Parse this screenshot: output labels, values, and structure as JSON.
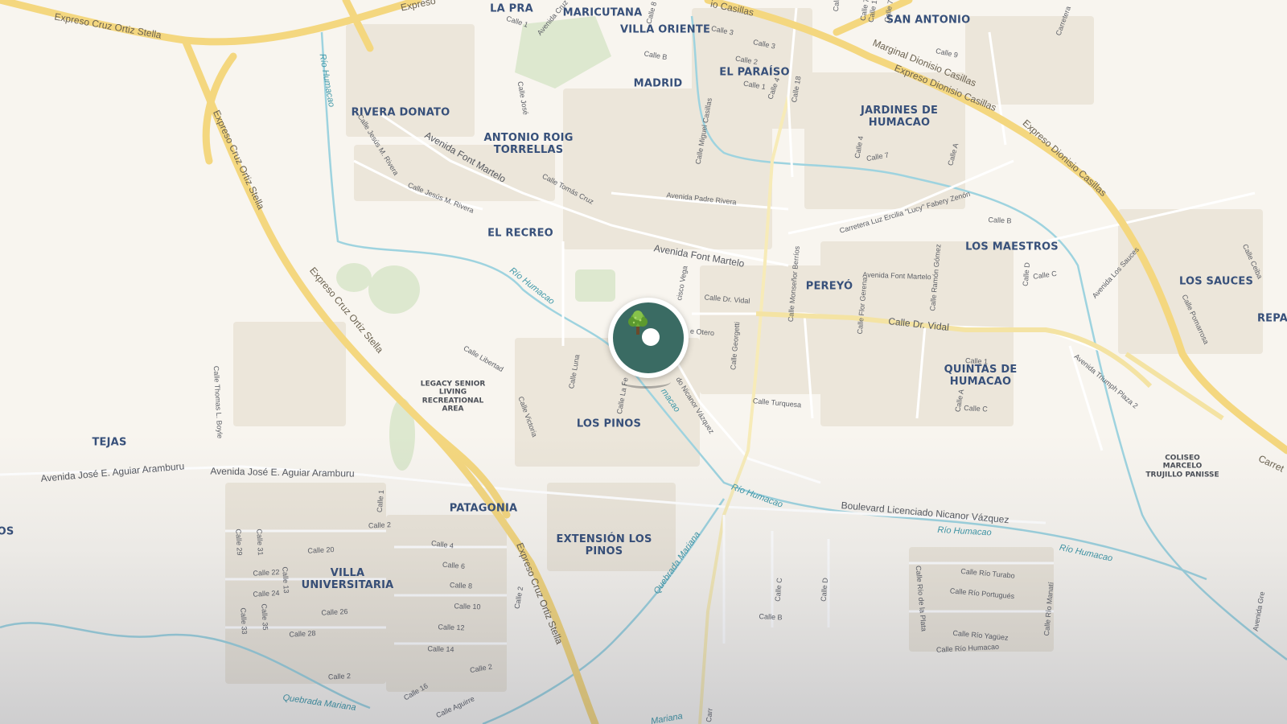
{
  "map": {
    "colors": {
      "background": "#f8f5ef",
      "highway": "#f4d77f",
      "water": "#9ed3df",
      "park": "#dde8cf",
      "street": "#ffffff",
      "marker": "#3a6b63"
    },
    "marker": {
      "icon": "tree-icon"
    },
    "neighborhoods": {
      "la_pra": "LA PRA",
      "maricutana": "MARICUTANA",
      "villa_oriente": "VILLA ORIENTE",
      "san_antonio": "SAN ANTONIO",
      "madrid": "MADRID",
      "el_paraiso": "EL PARAÍSO",
      "rivera_donato": "RIVERA DONATO",
      "antonio_roig_1": "ANTONIO ROIG",
      "antonio_roig_2": "TORRELLAS",
      "jardines_1": "JARDINES DE",
      "jardines_2": "HUMACAO",
      "el_recreo": "EL RECREO",
      "los_maestros": "LOS MAESTROS",
      "pereyo": "PEREYÓ",
      "los_sauces": "LOS SAUCES",
      "repa": "REPA",
      "quintas_1": "QUINTAS DE",
      "quintas_2": "HUMACAO",
      "tejas": "TEJAS",
      "los_pinos": "LOS PINOS",
      "patagonia": "PATAGONIA",
      "extension_1": "EXTENSIÓN LOS",
      "extension_2": "PINOS",
      "villa_univ_1": "VILLA",
      "villa_univ_2": "UNIVERSITARIA",
      "os": "OS"
    },
    "pois": {
      "legacy_1": "LEGACY SENIOR",
      "legacy_2": "LIVING",
      "legacy_3": "RECREATIONAL",
      "legacy_4": "AREA",
      "coliseo_1": "COLISEO",
      "coliseo_2": "MARCELO",
      "coliseo_3": "TRUJILLO PANISSE"
    },
    "highways": {
      "ecos_top": "Expreso Cruz Ortiz Stella",
      "ecos_left": "Expreso Cruz Ortiz Stella",
      "ecos_mid": "Expreso Cruz Ortiz Stella",
      "ecos_bottom": "Expreso Cruz Ortiz Stella",
      "expreso_top": "Expreso",
      "casillas_top": "io Casillas",
      "marginal": "Marginal Dionisio Casillas",
      "edc_1": "Expreso Dionisio Casillas",
      "edc_2": "Expreso Dionisio Casillas",
      "carret_right": "Carret"
    },
    "avenues": {
      "font_martelo_1": "Avenida Font Martelo",
      "font_martelo_2": "Avenida Font Martelo",
      "dr_vidal": "Calle Dr. Vidal",
      "aguiar_1": "Avenida José E. Aguiar Aramburu",
      "aguiar_2": "Avenida José E. Aguiar Aramburu",
      "boulevard": "Boulevard Licenciado Nicanor Vázquez",
      "carretera_luz": "Carretera Luz Ercilia \"Lucy\" Fabery Zenón",
      "nicanor": "do Nicanor Vázquez"
    },
    "streets": {
      "s1": "Calle 1",
      "s2": "Avenida Cruz",
      "s3": "Calle 8",
      "s4": "Calle 3",
      "s5": "Calle 3",
      "s6": "Calle B",
      "s7": "Calle 2",
      "s8": "Calle 1",
      "s9": "Calle 9",
      "s10": "Calle 7",
      "s11": "Calle 18",
      "s12": "Calle 4",
      "s13": "Calle Jesús M. Rivera",
      "s14": "Calle Jesús M. Rivera",
      "s15": "Calle Tomás Cruz",
      "s16": "Avenida Padre Rivera",
      "s17": "Calle Miguel Casillas",
      "s18": "Calle Dr. Vidal",
      "s19": "Calle Monseñor Berríos",
      "s20": "Calle Flor Gerena",
      "s21": "Calle Ramón Gómez",
      "s22": "Avenida Font Martelo",
      "s23": "Calle B",
      "s24": "Calle C",
      "s25": "Calle D",
      "s26": "Avenida Los Sauces",
      "s27": "Calle Ceiba",
      "s28": "Calle Pomarrosa",
      "s29": "Calle Libertad",
      "s30": "Calle Luna",
      "s31": "Calle La Fe",
      "s32": "Calle Victoria",
      "s33": "Calle Thomas L. Boyle",
      "s34": "Calle Georgetti",
      "s35": "Calle Turquesa",
      "s36": "Calle 1",
      "s37": "Calle A",
      "s38": "Calle C",
      "s39": "Avenida Triumph Plaza 2",
      "s40": "cisco Vega",
      "s41": "e Otero",
      "s42": "Calle 1",
      "s43": "Calle 2",
      "s44": "Calle 20",
      "s45": "Calle 22",
      "s46": "Calle 24",
      "s47": "Calle 26",
      "s48": "Calle 28",
      "s49": "Calle 4",
      "s50": "Calle 6",
      "s51": "Calle 8",
      "s52": "Calle 10",
      "s53": "Calle 12",
      "s54": "Calle 14",
      "s55": "Calle 2",
      "s56": "Calle 2",
      "s57": "Calle 16",
      "s58": "Calle Aguirre",
      "s59": "Calle 29",
      "s60": "Calle 31",
      "s61": "Calle 33",
      "s62": "Calle 35",
      "s63": "Calle 13",
      "s64": "Calle 2",
      "s65": "Calle C",
      "s66": "Calle D",
      "s67": "Calle B",
      "s68": "Calle Río Turabo",
      "s69": "Calle Río Portugués",
      "s70": "Calle Río de la Plata",
      "s71": "Calle Río Manatí",
      "s72": "Calle Río Yagüez",
      "s73": "Calle Río Humacao",
      "s74": "Calle 7",
      "s75": "Calle 4",
      "s76": "Calle A",
      "s77": "Calle 7",
      "s78": "Calle 1",
      "s79": "Calle",
      "s80": "Carr",
      "s81": "Carretera",
      "s82": "Calle José",
      "s83": "Avenida Gre"
    },
    "waters": {
      "rio_hum_1": "Río Humacao",
      "rio_hum_2": "Río Humacao",
      "rio_hum_3": "macao",
      "rio_hum_4": "Río Humacao",
      "rio_hum_5": "Río Humacao",
      "rio_hum_6": "Río Humacao",
      "qm_1": "Quebrada Mariana",
      "qm_2": "Quebrada Mariana",
      "qm_3": "Mariana"
    }
  }
}
